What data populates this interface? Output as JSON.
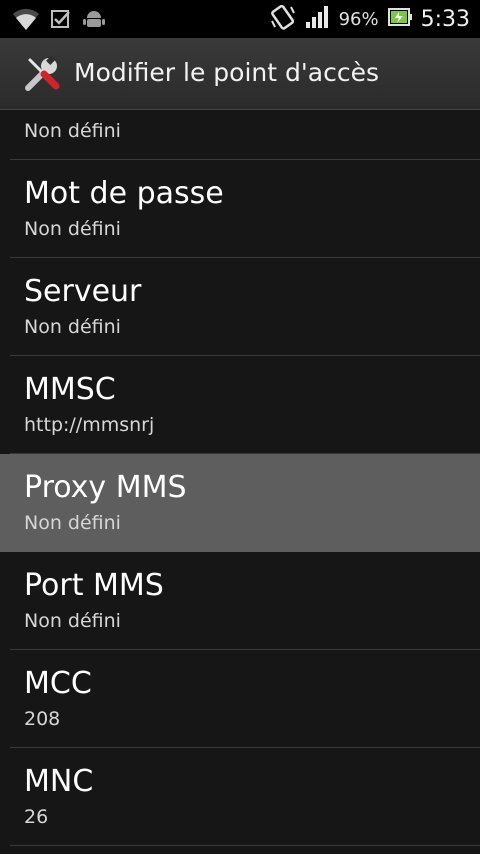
{
  "status_bar": {
    "battery_percent": "96%",
    "time": "5:33",
    "icons": [
      "wifi-icon",
      "checkbox-notification-icon",
      "android-debug-icon",
      "screen-rotate-icon",
      "signal-icon",
      "battery-icon"
    ]
  },
  "title_bar": {
    "title": "Modifier le point d'accès",
    "icon": "tools-icon"
  },
  "settings": {
    "partial_item": {
      "value": "Non défini"
    },
    "items": [
      {
        "label": "Mot de passe",
        "value": "Non défini"
      },
      {
        "label": "Serveur",
        "value": "Non défini"
      },
      {
        "label": "MMSC",
        "value": "http://mmsnrj"
      },
      {
        "label": "Proxy MMS",
        "value": "Non défini",
        "selected": true
      },
      {
        "label": "Port MMS",
        "value": "Non défini"
      },
      {
        "label": "MCC",
        "value": "208"
      },
      {
        "label": "MNC",
        "value": "26"
      }
    ]
  },
  "colors": {
    "background": "#161616",
    "selected_row": "#5e5e5e",
    "battery_green": "#7ac943"
  }
}
